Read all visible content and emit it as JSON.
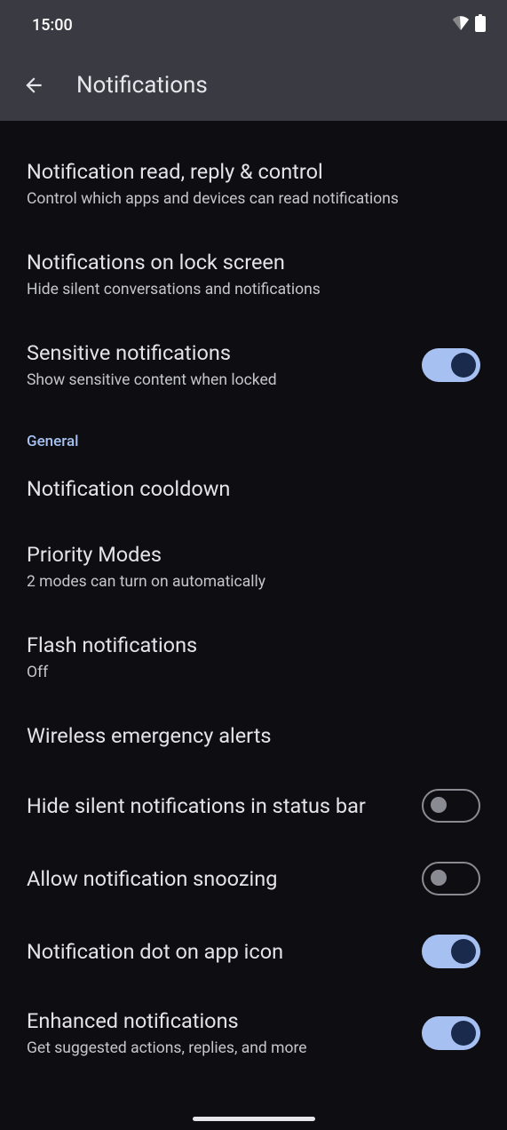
{
  "status": {
    "time": "15:00"
  },
  "header": {
    "title": "Notifications"
  },
  "sectionGeneral": "General",
  "items": [
    {
      "title": "Notification read, reply & control",
      "subtitle": "Control which apps and devices can read notifications",
      "toggle": null
    },
    {
      "title": "Notifications on lock screen",
      "subtitle": "Hide silent conversations and notifications",
      "toggle": null
    },
    {
      "title": "Sensitive notifications",
      "subtitle": "Show sensitive content when locked",
      "toggle": "on"
    }
  ],
  "generalItems": [
    {
      "title": "Notification cooldown",
      "subtitle": null,
      "toggle": null
    },
    {
      "title": "Priority Modes",
      "subtitle": "2 modes can turn on automatically",
      "toggle": null
    },
    {
      "title": "Flash notifications",
      "subtitle": "Off",
      "toggle": null
    },
    {
      "title": "Wireless emergency alerts",
      "subtitle": null,
      "toggle": null
    },
    {
      "title": "Hide silent notifications in status bar",
      "subtitle": null,
      "toggle": "off"
    },
    {
      "title": "Allow notification snoozing",
      "subtitle": null,
      "toggle": "off"
    },
    {
      "title": "Notification dot on app icon",
      "subtitle": null,
      "toggle": "on"
    },
    {
      "title": "Enhanced notifications",
      "subtitle": "Get suggested actions, replies, and more",
      "toggle": "on"
    }
  ]
}
